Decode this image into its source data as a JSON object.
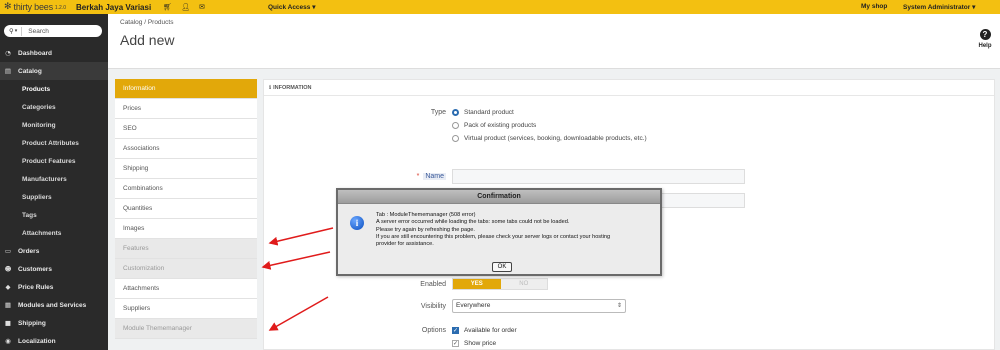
{
  "topbar": {
    "logo_text": "thirty bees",
    "logo_version": "1.2.0",
    "shop_name": "Berkah Jaya Variasi",
    "quick_access": "Quick Access ▾",
    "my_shop": "My shop",
    "admin_user": "System Administrator ▾",
    "icons": [
      "cart-icon",
      "user-icon",
      "envelope-icon"
    ]
  },
  "sidebar": {
    "search_placeholder": "Search",
    "items": [
      {
        "label": "Dashboard",
        "icon": "dashboard-icon"
      },
      {
        "label": "Catalog",
        "icon": "catalog-icon"
      },
      {
        "label": "Products"
      },
      {
        "label": "Categories"
      },
      {
        "label": "Monitoring"
      },
      {
        "label": "Product Attributes"
      },
      {
        "label": "Product Features"
      },
      {
        "label": "Manufacturers"
      },
      {
        "label": "Suppliers"
      },
      {
        "label": "Tags"
      },
      {
        "label": "Attachments"
      },
      {
        "label": "Orders",
        "icon": "orders-icon"
      },
      {
        "label": "Customers",
        "icon": "customers-icon"
      },
      {
        "label": "Price Rules",
        "icon": "price-rules-icon"
      },
      {
        "label": "Modules and Services",
        "icon": "modules-icon"
      },
      {
        "label": "Shipping",
        "icon": "shipping-icon"
      },
      {
        "label": "Localization",
        "icon": "localization-icon"
      }
    ]
  },
  "header": {
    "breadcrumb": "Catalog  /  Products",
    "title": "Add new",
    "help_label": "Help"
  },
  "tabs": [
    {
      "label": "Information",
      "state": "active"
    },
    {
      "label": "Prices",
      "state": "normal"
    },
    {
      "label": "SEO",
      "state": "normal"
    },
    {
      "label": "Associations",
      "state": "normal"
    },
    {
      "label": "Shipping",
      "state": "normal"
    },
    {
      "label": "Combinations",
      "state": "normal"
    },
    {
      "label": "Quantities",
      "state": "normal"
    },
    {
      "label": "Images",
      "state": "normal"
    },
    {
      "label": "Features",
      "state": "disabled"
    },
    {
      "label": "Customization",
      "state": "disabled"
    },
    {
      "label": "Attachments",
      "state": "normal"
    },
    {
      "label": "Suppliers",
      "state": "normal"
    },
    {
      "label": "Module Thememanager",
      "state": "disabled"
    }
  ],
  "panel": {
    "heading": "INFORMATION",
    "type_label": "Type",
    "type_options": [
      "Standard product",
      "Pack of existing products",
      "Virtual product (services, booking, downloadable products, etc.)"
    ],
    "type_selected": "Standard product",
    "name_label": "Name",
    "enabled_label": "Enabled",
    "enabled_yes": "YES",
    "enabled_no": "NO",
    "visibility_label": "Visibility",
    "visibility_value": "Everywhere",
    "options_label": "Options",
    "options": [
      {
        "label": "Available for order",
        "checked": true
      },
      {
        "label": "Show price",
        "checked": true
      }
    ]
  },
  "dialog": {
    "title": "Confirmation",
    "lines": [
      "Tab : ModuleThememanager (508 error)",
      "A server error occurred while loading the tabs: some tabs could not be loaded.",
      "Please try again by refreshing the page.",
      "If you are still encountering this problem, please check your server logs or contact your hosting",
      "provider for assistance."
    ],
    "ok_label": "OK"
  },
  "colors": {
    "topbar": "#f3c011",
    "sidebar": "#2a2a2a",
    "accent": "#e2a80a",
    "arrow": "#e01b1b"
  }
}
